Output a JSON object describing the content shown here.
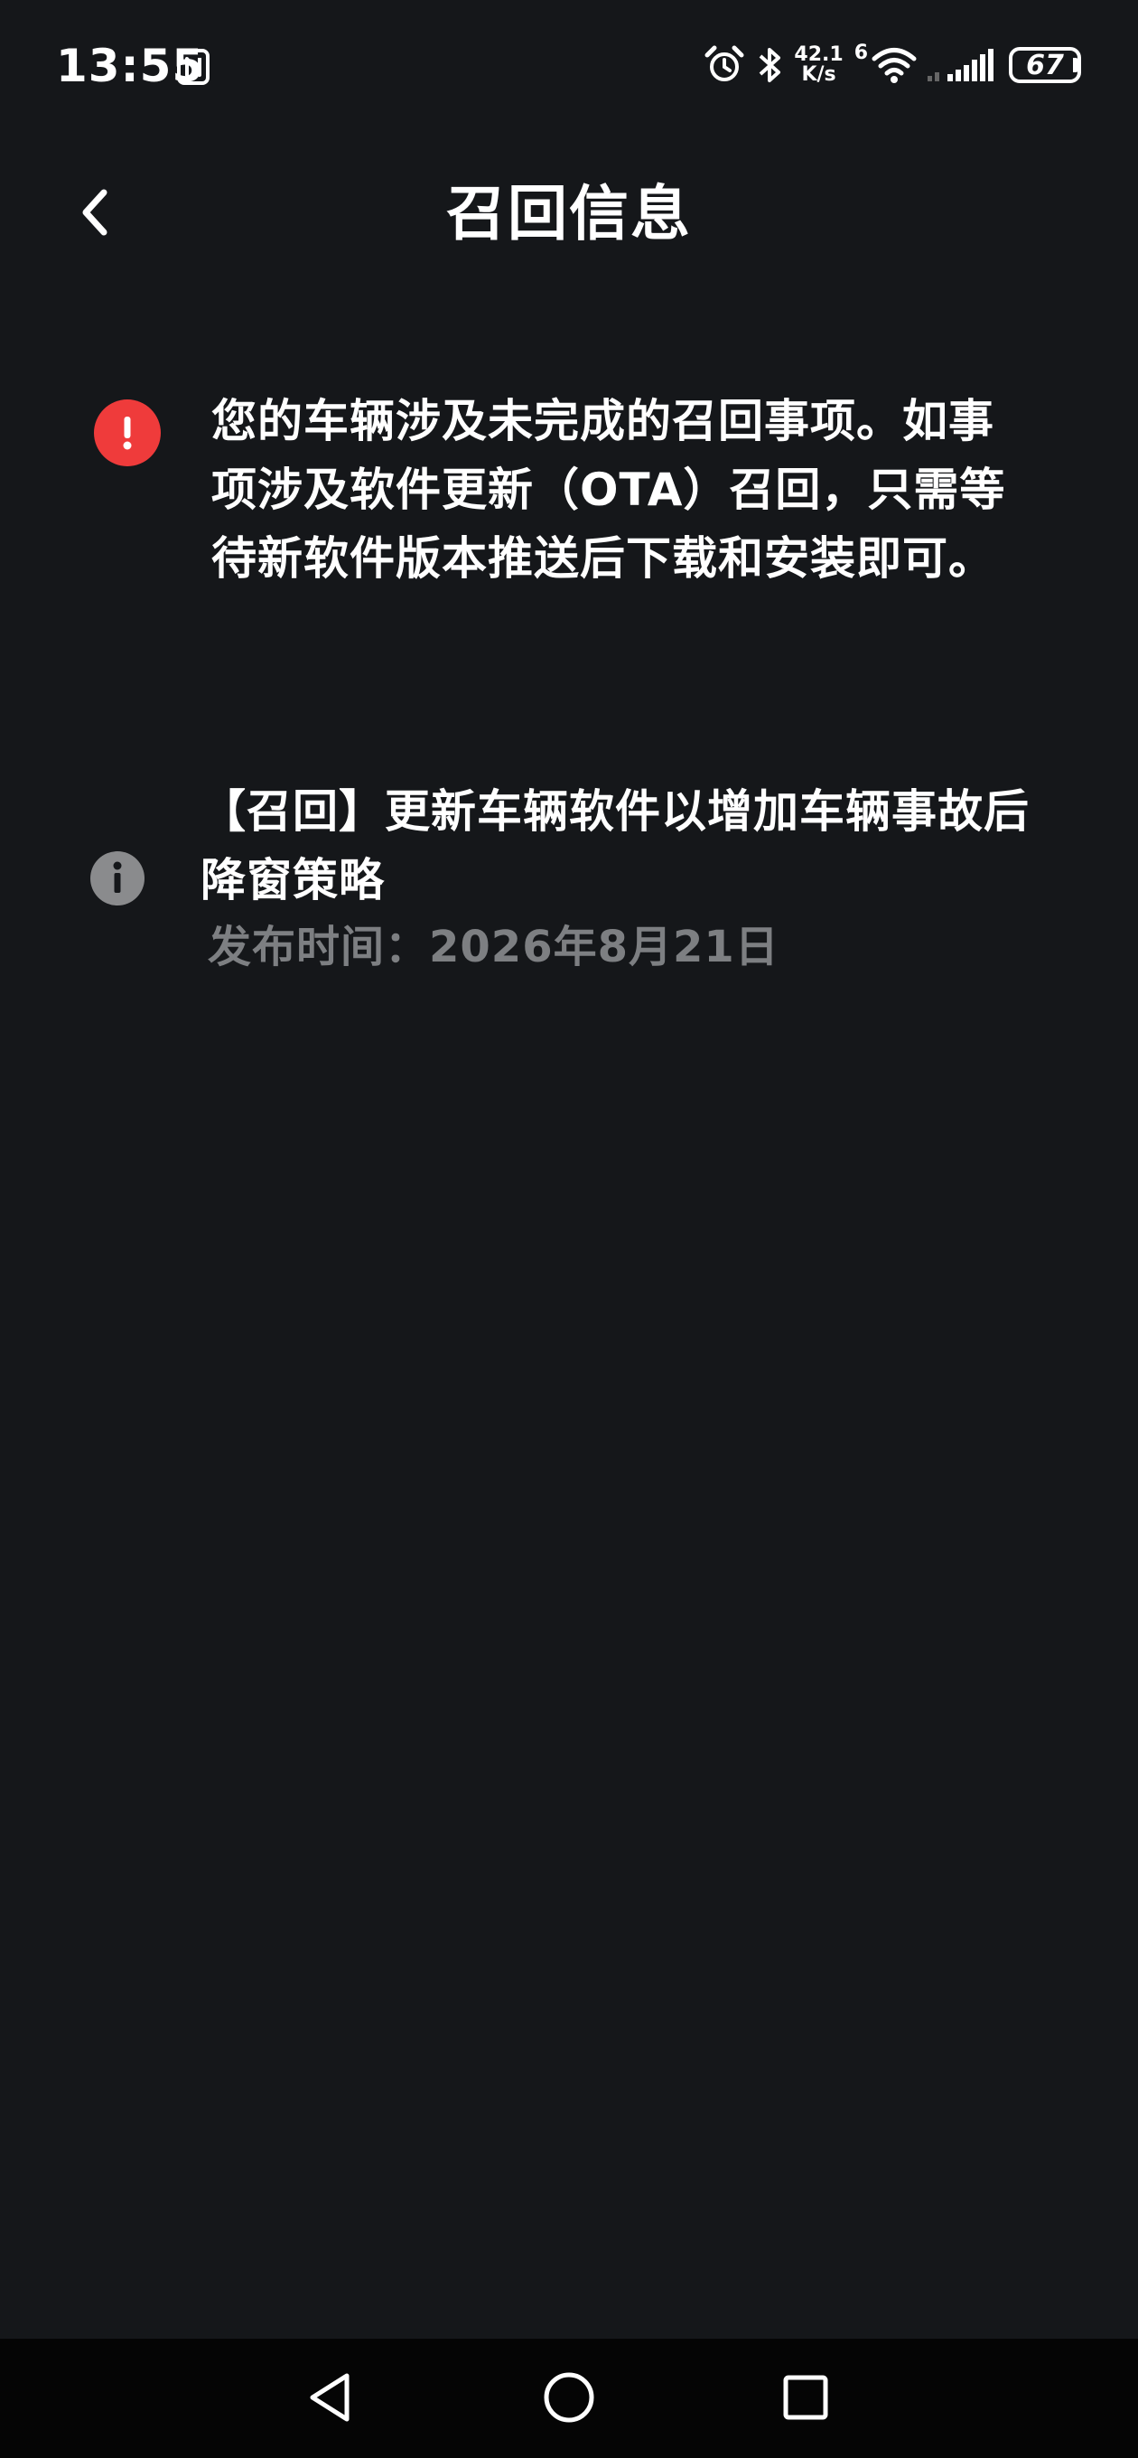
{
  "status_bar": {
    "time": "13:55",
    "net_speed_value": "42.1",
    "net_speed_unit": "K/s",
    "network_type": "6",
    "battery_level": "67",
    "icons": [
      "nfc-icon",
      "alarm-icon",
      "bluetooth-icon",
      "wifi-icon",
      "cellular-signal-icon",
      "battery-icon"
    ]
  },
  "header": {
    "title": "召回信息",
    "back_icon": "chevron-left-icon"
  },
  "alert": {
    "icon": "exclamation-circle-icon",
    "color": "#ef3b3b",
    "message": "您的车辆涉及未完成的召回事项。如事项涉及软件更新（OTA）召回，只需等待新软件版本推送后下载和安装即可。"
  },
  "recall_items": [
    {
      "icon": "info-circle-icon",
      "title": "【召回】更新车辆软件以增加车辆事故后降窗策略",
      "date": "发布时间：2026年8月21日"
    }
  ],
  "nav_bar": {
    "buttons": [
      "back-triangle-icon",
      "home-circle-icon",
      "recents-square-icon"
    ]
  },
  "colors": {
    "background": "#15171a",
    "text_primary": "#ffffff",
    "text_secondary": "#7d7f82",
    "nav_bar_background": "#050505"
  }
}
